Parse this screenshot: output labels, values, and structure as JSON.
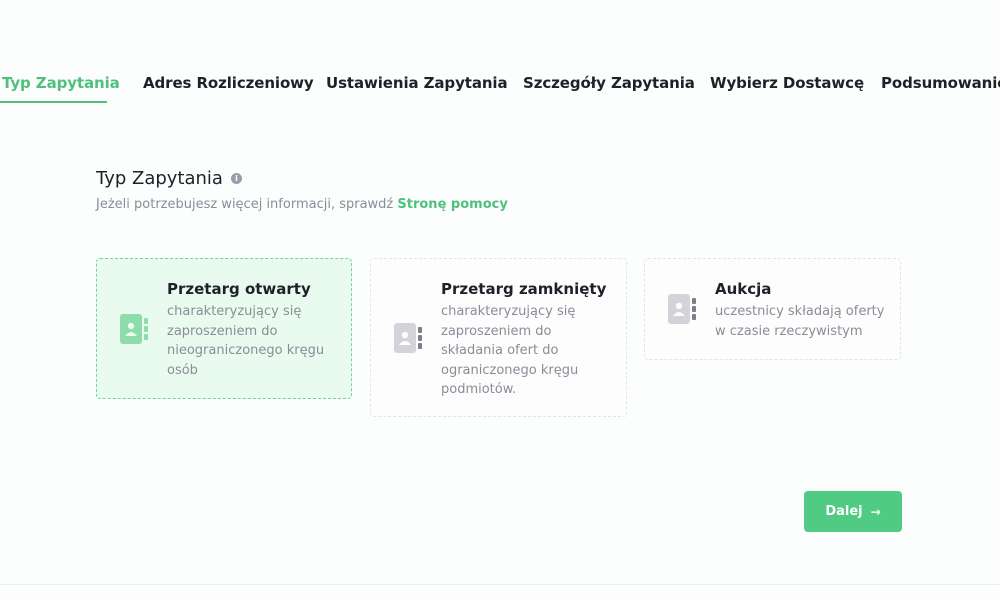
{
  "tabs": [
    {
      "label": "Typ Zapytania",
      "active": true
    },
    {
      "label": "Adres Rozliczeniowy",
      "active": false
    },
    {
      "label": "Ustawienia Zapytania",
      "active": false
    },
    {
      "label": "Szczegóły Zapytania",
      "active": false
    },
    {
      "label": "Wybierz Dostawcę",
      "active": false
    },
    {
      "label": "Podsumowanie",
      "active": false
    }
  ],
  "section": {
    "title": "Typ Zapytania",
    "info_icon": "info-icon",
    "help_text": "Jeżeli potrzebujesz więcej informacji, sprawdź",
    "help_link": "Stronę pomocy"
  },
  "options": [
    {
      "title": "Przetarg otwarty",
      "description": "charakteryzujący się zaproszeniem do nieograniczonego kręgu osób",
      "selected": true,
      "icon": "contact-book-icon"
    },
    {
      "title": "Przetarg zamknięty",
      "description": "charakteryzujący się zaproszeniem do składania ofert do ograniczonego kręgu podmiotów.",
      "selected": false,
      "icon": "contact-book-icon"
    },
    {
      "title": "Aukcja",
      "description": "uczestnicy składają oferty w czasie rzeczywistym",
      "selected": false,
      "icon": "contact-book-icon"
    }
  ],
  "actions": {
    "next_label": "Dalej",
    "next_icon": "arrow-right-icon"
  },
  "colors": {
    "accent": "#4fc17a",
    "button": "#4fcb84",
    "selected_card_bg": "#e8fbee",
    "icon_selected": "#8fdcab",
    "icon_default": "#c9cad2",
    "text_dark": "#1f2029",
    "text_muted": "#8a8d97"
  }
}
